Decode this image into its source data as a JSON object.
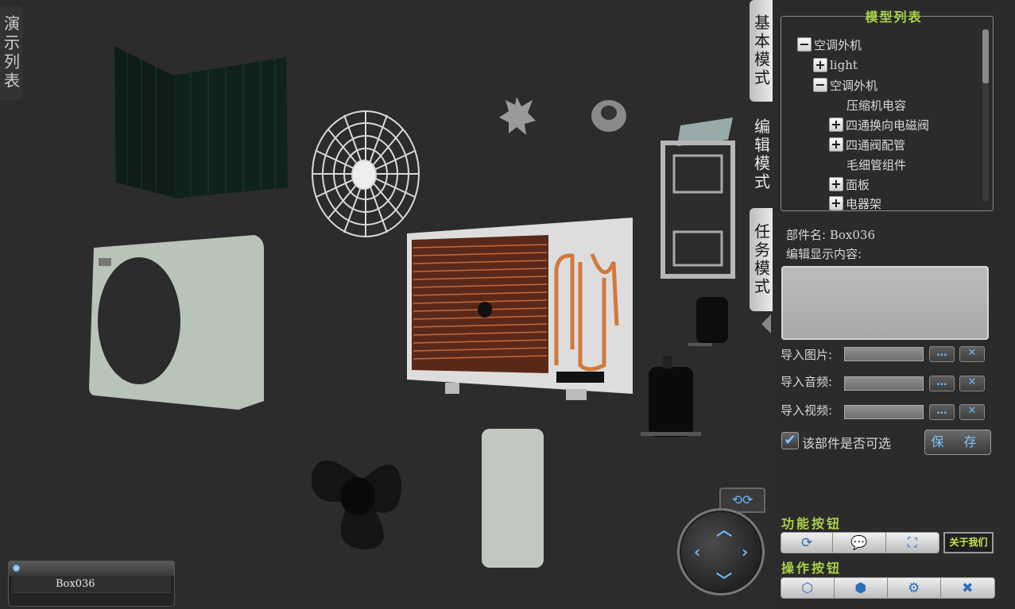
{
  "left_tab": {
    "label": "演示列表"
  },
  "selection_box": {
    "selected_name": "Box036"
  },
  "mode_tabs": {
    "basic": "基本模式",
    "edit": "编辑模式",
    "task": "任务模式"
  },
  "model_tree": {
    "title": "模型列表",
    "items": [
      {
        "label": "空调外机",
        "toggle": "−"
      },
      {
        "label": "light",
        "toggle": "+"
      },
      {
        "label": "空调外机",
        "toggle": "−"
      },
      {
        "label": "压缩机电容",
        "toggle": ""
      },
      {
        "label": "四通换向电磁阀",
        "toggle": "+"
      },
      {
        "label": "四通阀配管",
        "toggle": "+"
      },
      {
        "label": "毛细管组件",
        "toggle": ""
      },
      {
        "label": "面板",
        "toggle": "+"
      },
      {
        "label": "电器架",
        "toggle": "+"
      }
    ]
  },
  "part": {
    "name_label": "部件名:",
    "name_value": "Box036",
    "edit_label": "编辑显示内容:"
  },
  "imports": {
    "image_label": "导入图片:",
    "audio_label": "导入音频:",
    "video_label": "导入视频:",
    "browse_label": "…",
    "clear_label": "✕"
  },
  "selectable": {
    "label": "该部件是否可选",
    "checked": true
  },
  "save_label": "保 存",
  "function_buttons": {
    "title": "功能按钮",
    "about_label": "关于我们"
  },
  "operation_buttons": {
    "title": "操作按钮"
  },
  "colors": {
    "accent_green": "#a8d24a",
    "accent_blue": "#6cb6ff"
  }
}
